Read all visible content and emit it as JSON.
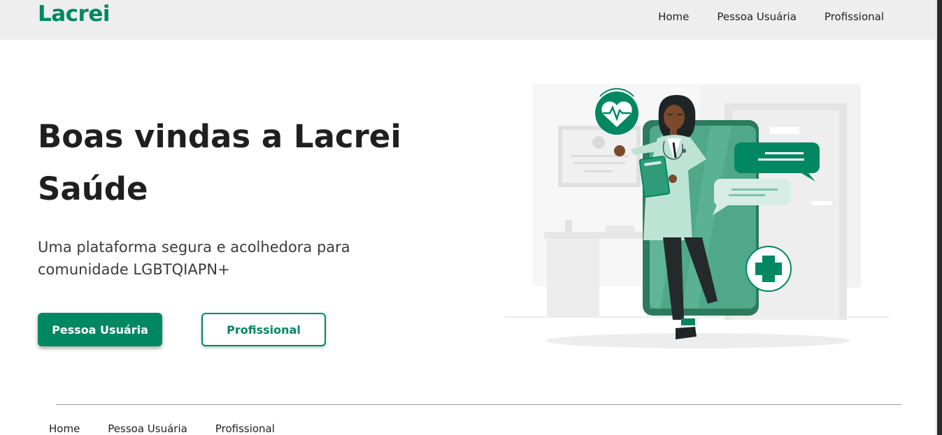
{
  "header": {
    "brand": "Lacrei",
    "nav": [
      {
        "label": "Home"
      },
      {
        "label": "Pessoa Usuária"
      },
      {
        "label": "Profissional"
      }
    ]
  },
  "hero": {
    "title": "Boas vindas a Lacrei Saúde",
    "subtitle": "Uma plataforma segura e acolhedora para comunidade LGBTQIAPN+",
    "primary_button": "Pessoa Usuária",
    "secondary_button": "Profissional"
  },
  "illustration": {
    "icons": [
      "heart-pulse-icon",
      "medical-cross-icon",
      "chat-bubble-icon"
    ]
  },
  "footer": {
    "nav": [
      {
        "label": "Home"
      },
      {
        "label": "Pessoa Usuária"
      },
      {
        "label": "Profissional"
      }
    ]
  },
  "colors": {
    "accent": "#018762",
    "header_bg": "#eeeeee",
    "text": "#1f1f1f"
  }
}
